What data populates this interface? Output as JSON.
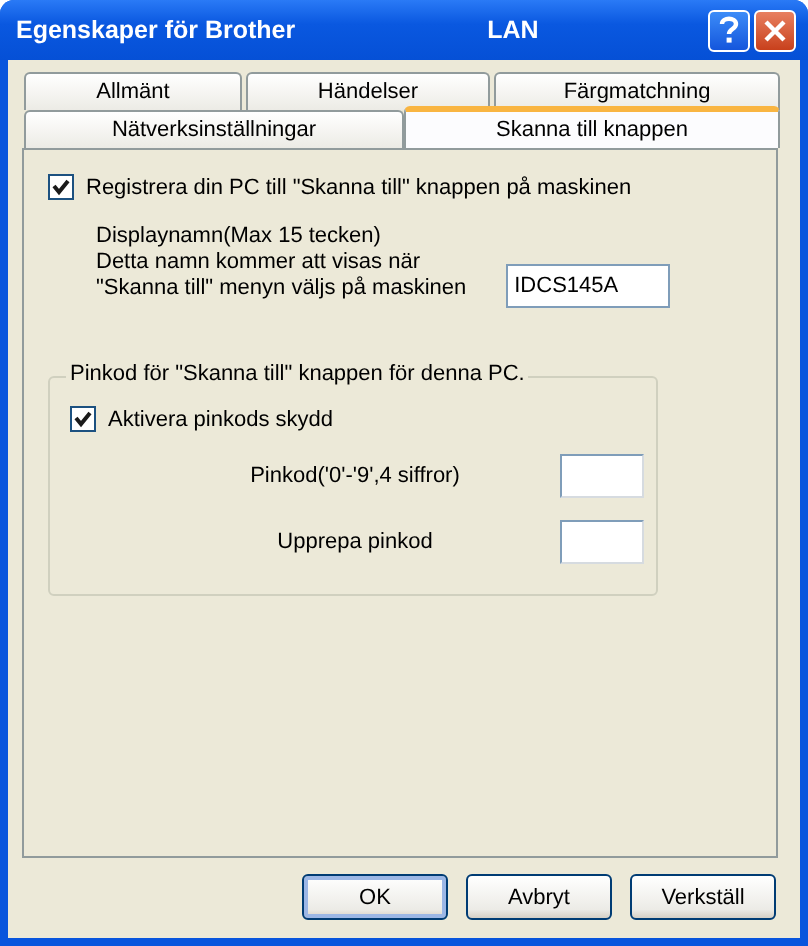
{
  "window": {
    "title": "Egenskaper för Brother",
    "title_suffix": "LAN"
  },
  "tab_rows": [
    {
      "tabs": [
        {
          "label": "Allmänt",
          "selected": false
        },
        {
          "label": "Händelser",
          "selected": false
        },
        {
          "label": "Färgmatchning",
          "selected": false
        }
      ]
    },
    {
      "tabs": [
        {
          "label": "Nätverksinställningar",
          "selected": false
        },
        {
          "label": "Skanna till knappen",
          "selected": true
        }
      ]
    }
  ],
  "register": {
    "label": "Registrera din PC till \"Skanna till\" knappen på maskinen",
    "checked": true
  },
  "display_name": {
    "lines": [
      "Displaynamn(Max 15 tecken)",
      "Detta namn kommer att visas när",
      "\"Skanna till\" menyn väljs på maskinen"
    ],
    "value": "IDCS145A"
  },
  "pin_group": {
    "title": "Pinkod för \"Skanna till\" knappen för denna PC.",
    "enable": {
      "label": "Aktivera pinkods skydd",
      "checked": true
    },
    "fields": [
      {
        "label": "Pinkod('0'-'9',4 siffror)"
      },
      {
        "label": "Upprepa pinkod"
      }
    ]
  },
  "buttons": [
    {
      "label": "OK",
      "default": true
    },
    {
      "label": "Avbryt",
      "default": false
    },
    {
      "label": "Verkställ",
      "default": false
    }
  ]
}
